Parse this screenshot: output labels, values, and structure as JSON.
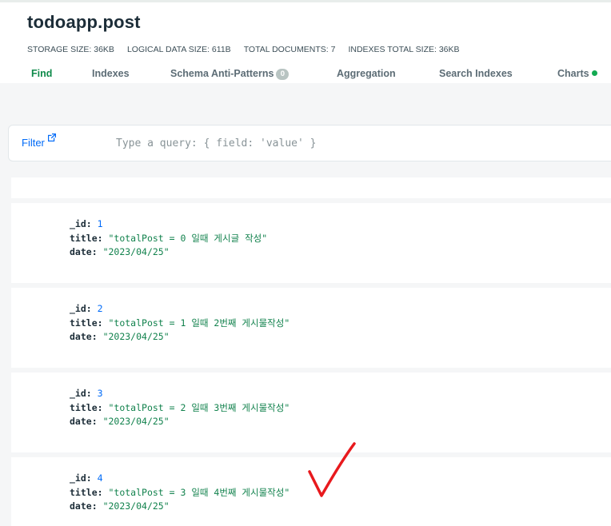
{
  "header": {
    "namespace": "todoapp.post",
    "stats": [
      "STORAGE SIZE: 36KB",
      "LOGICAL DATA SIZE: 611B",
      "TOTAL DOCUMENTS: 7",
      "INDEXES TOTAL SIZE: 36KB"
    ],
    "tabs": {
      "find": "Find",
      "indexes": "Indexes",
      "schema_anti_patterns": "Schema Anti-Patterns",
      "schema_anti_patterns_count": "0",
      "aggregation": "Aggregation",
      "search_indexes": "Search Indexes",
      "charts": "Charts"
    }
  },
  "filter": {
    "label": "Filter",
    "placeholder": "Type a query: { field: 'value' }"
  },
  "documents": [
    {
      "id_key": "_id:",
      "id": "1",
      "title_key": "title:",
      "title": "\"totalPost = 0 일때 게시글 작성\"",
      "date_key": "date:",
      "date": "\"2023/04/25\""
    },
    {
      "id_key": "_id:",
      "id": "2",
      "title_key": "title:",
      "title": "\"totalPost = 1 일때 2번째 게시물작성\"",
      "date_key": "date:",
      "date": "\"2023/04/25\""
    },
    {
      "id_key": "_id:",
      "id": "3",
      "title_key": "title:",
      "title": "\"totalPost = 2 일때 3번째 게시물작성\"",
      "date_key": "date:",
      "date": "\"2023/04/25\""
    },
    {
      "id_key": "_id:",
      "id": "4",
      "title_key": "title:",
      "title": "\"totalPost = 3 일때 4번째 게시물작성\"",
      "date_key": "date:",
      "date": "\"2023/04/25\""
    }
  ],
  "colors": {
    "active_tab": "#0e8a4a",
    "link": "#016bf8",
    "string_value": "#12824d",
    "annotation_check": "#e8191d"
  },
  "icons": {
    "filter_external": "external-link-icon",
    "charts_status": "status-dot-icon",
    "annotation": "red-checkmark-annotation"
  }
}
